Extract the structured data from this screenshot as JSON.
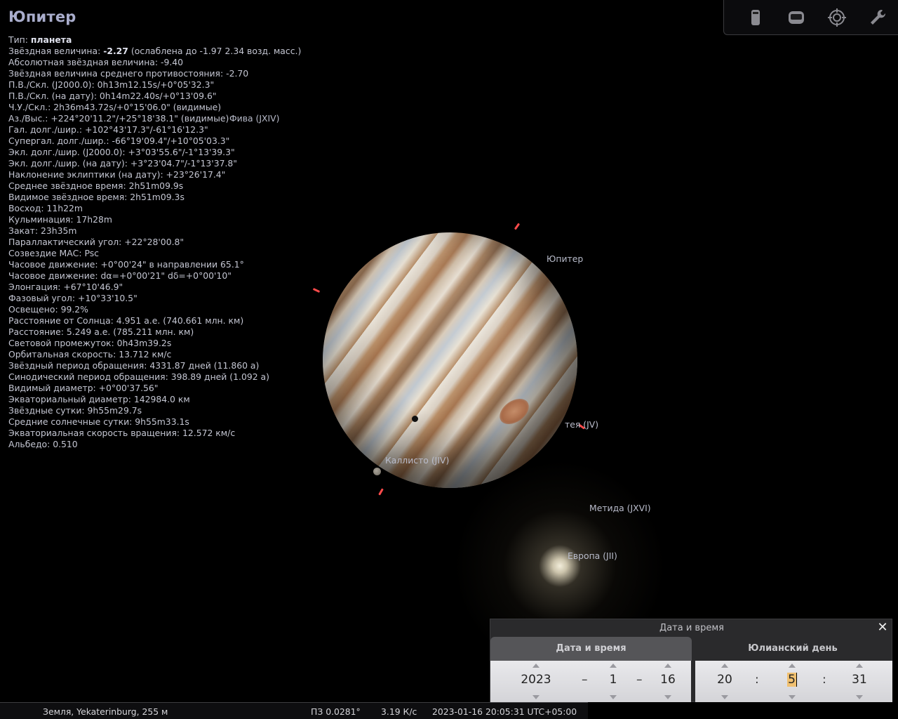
{
  "object": {
    "title": "Юпитер",
    "info": [
      {
        "label": "Тип: ",
        "bold": "планета",
        "rest": ""
      },
      {
        "label": "Звёздная величина: ",
        "bold": "-2.27",
        "rest": " (ослаблена до -1.97 2.34 возд. масс.)"
      },
      {
        "label": "Абсолютная звёздная величина: -9.40",
        "bold": "",
        "rest": ""
      },
      {
        "label": "Звёздная величина среднего противостояния: -2.70",
        "bold": "",
        "rest": ""
      },
      {
        "label": "П.В./Скл. (J2000.0): 0h13m12.15s/+0°05'32.3\"",
        "bold": "",
        "rest": ""
      },
      {
        "label": "П.В./Скл. (на дату): 0h14m22.40s/+0°13'09.6\"",
        "bold": "",
        "rest": ""
      },
      {
        "label": "Ч.У./Скл.: 2h36m43.72s/+0°15'06.0\" (видимые)",
        "bold": "",
        "rest": ""
      },
      {
        "label": "Аз./Выс.: +224°20'11.2\"/+25°18'38.1\" (видимые)",
        "bold": "",
        "rest": ""
      },
      {
        "label": "Гал. долг./шир.: +102°43'17.3\"/-61°16'12.3\"",
        "bold": "",
        "rest": ""
      },
      {
        "label": "Супергал. долг./шир.: -66°19'09.4\"/+10°05'03.3\"",
        "bold": "",
        "rest": ""
      },
      {
        "label": "Экл. долг./шир. (J2000.0): +3°03'55.6\"/-1°13'39.3\"",
        "bold": "",
        "rest": ""
      },
      {
        "label": "Экл. долг./шир. (на дату): +3°23'04.7\"/-1°13'37.8\"",
        "bold": "",
        "rest": ""
      },
      {
        "label": "Наклонение эклиптики (на дату): +23°26'17.4\"",
        "bold": "",
        "rest": ""
      },
      {
        "label": "Среднее звёздное время: 2h51m09.9s",
        "bold": "",
        "rest": ""
      },
      {
        "label": "Видимое звёздное время: 2h51m09.3s",
        "bold": "",
        "rest": ""
      },
      {
        "label": "Восход: 11h22m",
        "bold": "",
        "rest": ""
      },
      {
        "label": "Кульминация: 17h28m",
        "bold": "",
        "rest": ""
      },
      {
        "label": "Закат: 23h35m",
        "bold": "",
        "rest": ""
      },
      {
        "label": "Параллактический угол: +22°28'00.8\"",
        "bold": "",
        "rest": ""
      },
      {
        "label": "Созвездие МАС: Psc",
        "bold": "",
        "rest": ""
      },
      {
        "label": "Часовое движение: +0°00'24\" в направлении 65.1°",
        "bold": "",
        "rest": ""
      },
      {
        "label": "Часовое движение: dα=+0°00'21\" dδ=+0°00'10\"",
        "bold": "",
        "rest": ""
      },
      {
        "label": "Элонгация: +67°10'46.9\"",
        "bold": "",
        "rest": ""
      },
      {
        "label": "Фазовый угол: +10°33'10.5\"",
        "bold": "",
        "rest": ""
      },
      {
        "label": "Освещено: 99.2%",
        "bold": "",
        "rest": ""
      },
      {
        "label": "Расстояние от Солнца: 4.951 а.е. (740.661 млн. км)",
        "bold": "",
        "rest": ""
      },
      {
        "label": "Расстояние: 5.249 а.е. (785.211 млн. км)",
        "bold": "",
        "rest": ""
      },
      {
        "label": "Световой промежуток: 0h43m39.2s",
        "bold": "",
        "rest": ""
      },
      {
        "label": "Орбитальная скорость: 13.712 км/с",
        "bold": "",
        "rest": ""
      },
      {
        "label": "Звёздный период обращения: 4331.87 дней (11.860 а)",
        "bold": "",
        "rest": ""
      },
      {
        "label": "Синодический период обращения: 398.89 дней (1.092 а)",
        "bold": "",
        "rest": ""
      },
      {
        "label": "Видимый диаметр: +0°00'37.56\"",
        "bold": "",
        "rest": ""
      },
      {
        "label": "Экваториальный диаметр: 142984.0 км",
        "bold": "",
        "rest": ""
      },
      {
        "label": "Звёздные сутки: 9h55m29.7s",
        "bold": "",
        "rest": ""
      },
      {
        "label": "Средние солнечные сутки: 9h55m33.1s",
        "bold": "",
        "rest": ""
      },
      {
        "label": "Экваториальная скорость вращения: 12.572 км/с",
        "bold": "",
        "rest": ""
      },
      {
        "label": "Альбедо: 0.510",
        "bold": "",
        "rest": ""
      }
    ]
  },
  "sky_labels": {
    "jupiter": "Юпитер",
    "theba": "Фива (JXIV)",
    "amalthea": "тея (JV)",
    "callisto": "Каллисто (JIV)",
    "metis": "Метида (JXVI)",
    "europa": "Европа (JII)"
  },
  "toolbar": {
    "icons": [
      "telescope-icon",
      "ocular-icon",
      "target-icon",
      "wrench-icon"
    ]
  },
  "datetime_dialog": {
    "title": "Дата и время",
    "tab_datetime": "Дата и время",
    "tab_julian": "Юлианский день",
    "year": "2023",
    "month": "1",
    "day": "16",
    "hour": "20",
    "minute": "5",
    "second": "31",
    "date_sep": "–",
    "time_sep": ":"
  },
  "statusbar": {
    "location": "Земля, Yekaterinburg, 255 м",
    "fov": "ПЗ 0.0281°",
    "fps": "3.19 К/с",
    "datetime": "2023-01-16 20:05:31 UTC+05:00"
  },
  "colors": {
    "marker": "#ff4b4b",
    "title": "#a9adcc",
    "dialog_bg": "#2a2a2c"
  }
}
